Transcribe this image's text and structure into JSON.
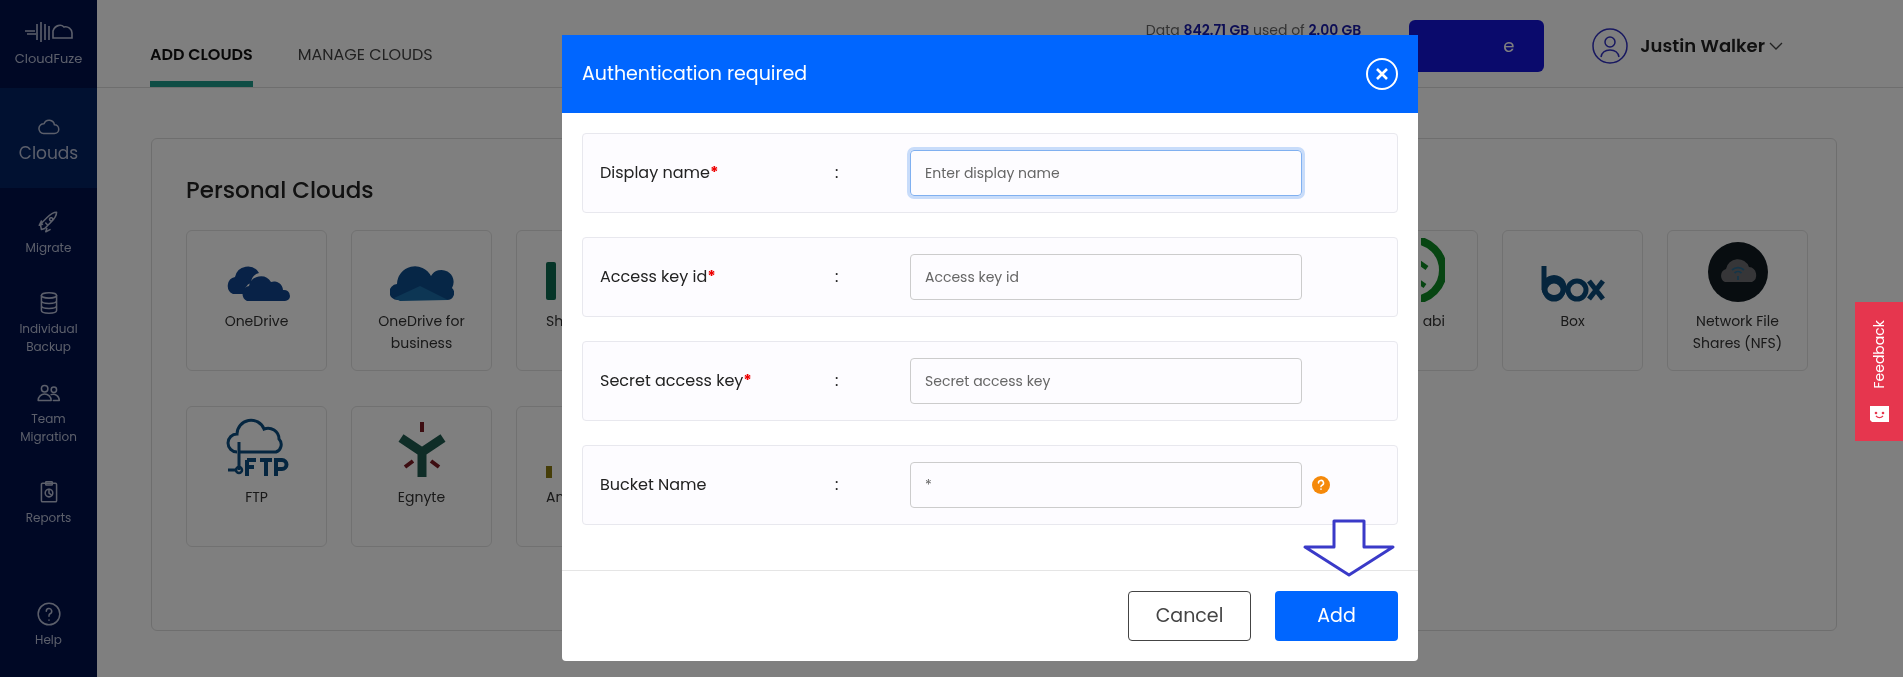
{
  "sidebar": {
    "brand": "CloudFuze",
    "items": [
      {
        "label": "Clouds",
        "selected": true
      },
      {
        "label": "Migrate",
        "selected": false
      },
      {
        "label": "Individual Backup",
        "selected": false
      },
      {
        "label": "Team Migration",
        "selected": false
      },
      {
        "label": "Reports",
        "selected": false
      },
      {
        "label": "Help",
        "selected": false
      }
    ]
  },
  "tabs": [
    {
      "label": "ADD CLOUDS",
      "selected": true
    },
    {
      "label": "MANAGE CLOUDS",
      "selected": false
    }
  ],
  "usage": "Data **842.71 GB** used of **2.00 GB**",
  "upgrade_button": "e",
  "user": {
    "name": "Justin Walker"
  },
  "panel": {
    "title": "Personal Clouds",
    "rows": [
      [
        {
          "label": "OneDrive",
          "kind": "full"
        },
        {
          "label": "OneDrive for business",
          "kind": "full"
        },
        {
          "label": "Sh",
          "kind": "cut_right"
        },
        null,
        null,
        null,
        null,
        {
          "label": "abi",
          "kind": "cut_left"
        },
        {
          "label": "Box",
          "kind": "full"
        },
        {
          "label": "Network File Shares (NFS)",
          "kind": "full"
        }
      ],
      [
        {
          "label": "FTP",
          "kind": "full"
        },
        {
          "label": "Egnyte",
          "kind": "full"
        },
        {
          "label": "An",
          "kind": "cut_right"
        }
      ]
    ]
  },
  "feedback": "Feedback",
  "dialog": {
    "title": "Authentication required",
    "fields": [
      {
        "label": "Display name",
        "required": true,
        "separator": ":",
        "placeholder": "Enter display name",
        "focused": true,
        "help": false
      },
      {
        "label": "Access key id",
        "required": true,
        "separator": ":",
        "placeholder": "Access key id",
        "focused": false,
        "help": false
      },
      {
        "label": "Secret access key",
        "required": true,
        "separator": ":",
        "placeholder": "Secret access key",
        "focused": false,
        "help": false
      },
      {
        "label": "Bucket Name",
        "required": false,
        "separator": ":",
        "placeholder": "*",
        "focused": false,
        "help": true
      }
    ],
    "buttons": [
      {
        "label": "Cancel",
        "kind": "secondary"
      },
      {
        "label": "Add",
        "kind": "primary"
      }
    ]
  }
}
